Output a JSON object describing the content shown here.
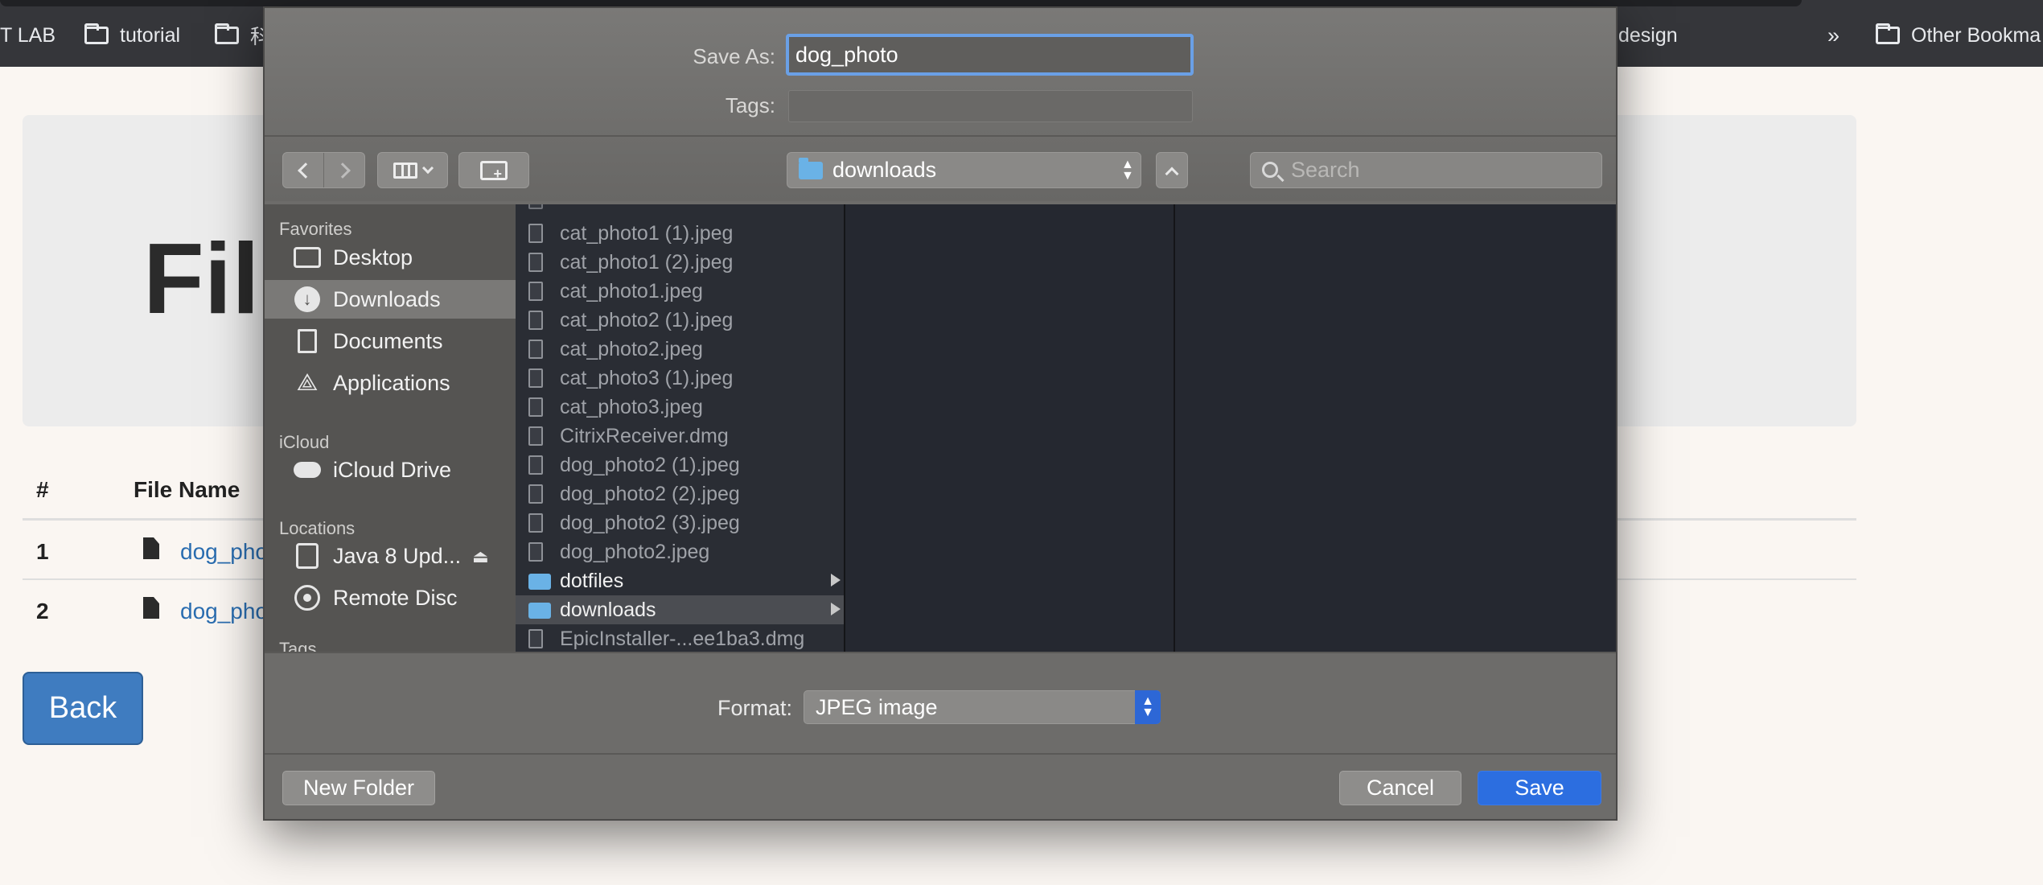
{
  "bookmarks": {
    "items": [
      "T LAB",
      "tutorial",
      "科",
      "design",
      "»",
      "Other Bookma"
    ]
  },
  "page": {
    "title": "File",
    "table": {
      "headers": [
        "#",
        "File Name"
      ],
      "rows": [
        {
          "num": "1",
          "file": "dog_pho"
        },
        {
          "num": "2",
          "file": "dog_pho"
        }
      ]
    },
    "back_label": "Back"
  },
  "dialog": {
    "save_as_label": "Save As:",
    "save_as_value": "dog_photo",
    "tags_label": "Tags:",
    "location": "downloads",
    "search_placeholder": "Search",
    "sidebar": {
      "favorites_label": "Favorites",
      "favorites": [
        "Desktop",
        "Downloads",
        "Documents",
        "Applications"
      ],
      "icloud_label": "iCloud",
      "icloud": [
        "iCloud Drive"
      ],
      "locations_label": "Locations",
      "locations": [
        "Java 8 Upd...",
        "Remote Disc"
      ],
      "tags_label": "Tags"
    },
    "files": [
      {
        "name": "cat_photo1 (1).jpeg",
        "kind": "file"
      },
      {
        "name": "cat_photo1 (2).jpeg",
        "kind": "file"
      },
      {
        "name": "cat_photo1.jpeg",
        "kind": "file"
      },
      {
        "name": "cat_photo2 (1).jpeg",
        "kind": "file"
      },
      {
        "name": "cat_photo2.jpeg",
        "kind": "file"
      },
      {
        "name": "cat_photo3 (1).jpeg",
        "kind": "file"
      },
      {
        "name": "cat_photo3.jpeg",
        "kind": "file"
      },
      {
        "name": "CitrixReceiver.dmg",
        "kind": "file"
      },
      {
        "name": "dog_photo2 (1).jpeg",
        "kind": "file"
      },
      {
        "name": "dog_photo2 (2).jpeg",
        "kind": "file"
      },
      {
        "name": "dog_photo2 (3).jpeg",
        "kind": "file"
      },
      {
        "name": "dog_photo2.jpeg",
        "kind": "file"
      },
      {
        "name": "dotfiles",
        "kind": "folder"
      },
      {
        "name": "downloads",
        "kind": "folder",
        "selected": true
      },
      {
        "name": "EpicInstaller-...ee1ba3.dmg",
        "kind": "file"
      }
    ],
    "format_label": "Format:",
    "format_value": "JPEG image",
    "new_folder_label": "New Folder",
    "cancel_label": "Cancel",
    "save_label": "Save"
  },
  "colors": {
    "accent": "#2c6ee0",
    "link": "#2a6db0",
    "back_button": "#3f7cc0"
  }
}
